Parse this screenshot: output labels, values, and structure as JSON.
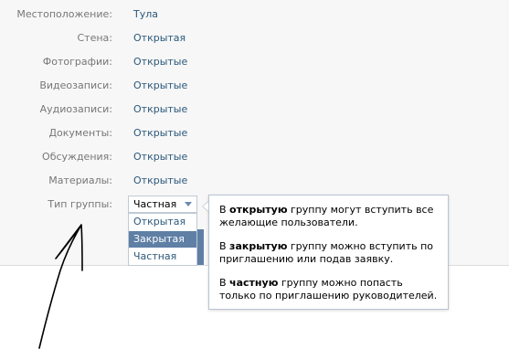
{
  "settings": {
    "rows": [
      {
        "label": "Местоположение:",
        "value": "Тула"
      },
      {
        "label": "Стена:",
        "value": "Открытая"
      },
      {
        "label": "Фотографии:",
        "value": "Открытые"
      },
      {
        "label": "Видеозаписи:",
        "value": "Открытые"
      },
      {
        "label": "Аудиозаписи:",
        "value": "Открытые"
      },
      {
        "label": "Документы:",
        "value": "Открытые"
      },
      {
        "label": "Обсуждения:",
        "value": "Открытые"
      },
      {
        "label": "Материалы:",
        "value": "Открытые"
      }
    ],
    "group_type": {
      "label": "Тип группы:",
      "selected": "Частная",
      "options": [
        "Открытая",
        "Закрытая",
        "Частная"
      ],
      "hovered_option": "Закрытая"
    }
  },
  "tooltip": {
    "open": {
      "pre": "В ",
      "bold": "открытую",
      "post": " группу могут вступить все желающие пользователи."
    },
    "closed": {
      "pre": "В ",
      "bold": "закрытую",
      "post": " группу можно вступить по приглашению или подав заявку."
    },
    "private": {
      "pre": "В ",
      "bold": "частную",
      "post": " группу можно попасть только по приглашению руководителей."
    }
  },
  "colors": {
    "link": "#2b587a",
    "label": "#777777",
    "panel_bg": "#f7f7f7",
    "highlight": "#5f7fa5"
  },
  "annotation": {
    "icon": "hand-drawn-arrow-icon"
  }
}
